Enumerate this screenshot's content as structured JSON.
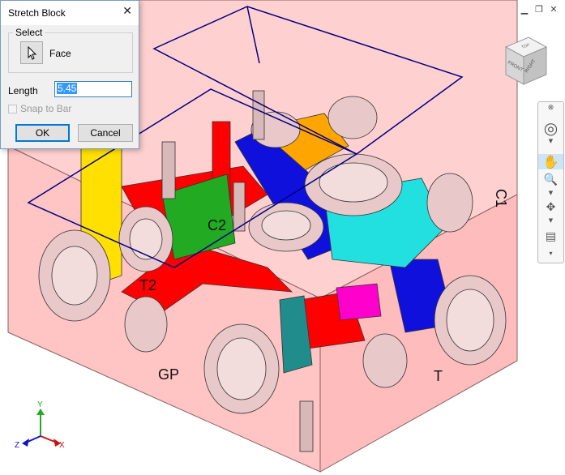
{
  "dialog": {
    "title": "Stretch Block",
    "close_icon": "close-icon",
    "select_group_label": "Select",
    "select_button_icon": "cursor-arrow-icon",
    "select_value": "Face",
    "length_label": "Length",
    "length_value": "5.45",
    "snap_label": "Snap to Bar",
    "ok_label": "OK",
    "cancel_label": "Cancel"
  },
  "viewcube": {
    "top": "TOP",
    "front": "FRONT",
    "right": "RIGHT"
  },
  "ports": {
    "t2": "T2",
    "c2": "C2",
    "gp": "GP",
    "t": "T",
    "c1": "C1"
  },
  "axes": {
    "x": "X",
    "y": "Y",
    "z": "Z"
  },
  "colors": {
    "block": "#ffc8c8",
    "red": "#ff0000",
    "green": "#22aa22",
    "yellow": "#ffe000",
    "orange": "#ffa500",
    "blue": "#1010dd",
    "cyan": "#22e0e0",
    "magenta": "#ff00cc",
    "teal": "#208c8c",
    "outline": "#000080"
  }
}
